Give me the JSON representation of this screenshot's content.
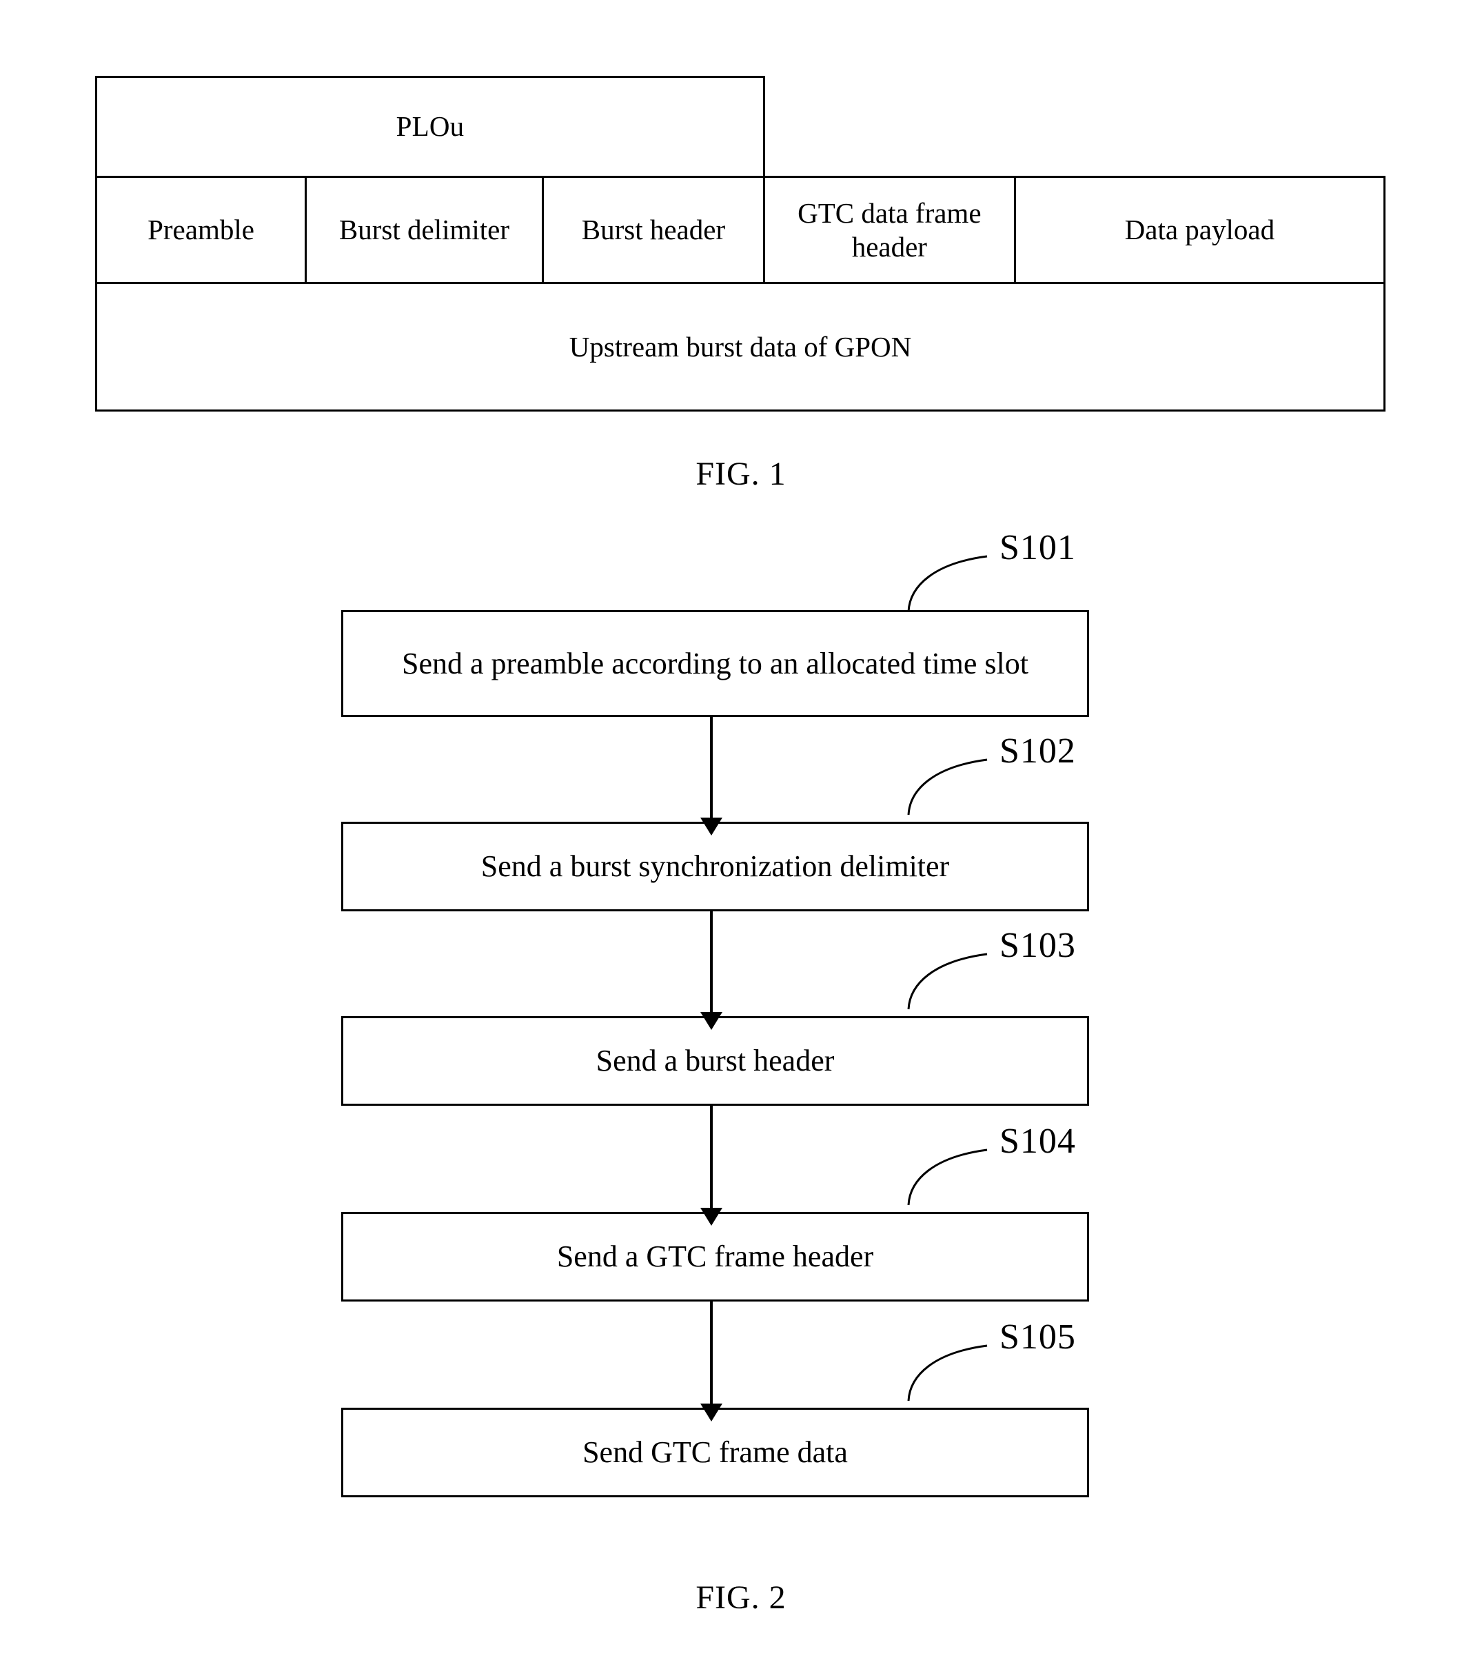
{
  "figure1": {
    "caption": "FIG. 1",
    "ploue_row": {
      "label": "PLOu"
    },
    "component_row": [
      {
        "label": "Preamble"
      },
      {
        "label": "Burst delimiter"
      },
      {
        "label": "Burst header"
      },
      {
        "label": "GTC data frame header"
      },
      {
        "label": "Data payload"
      }
    ],
    "summary_row": {
      "label": "Upstream burst data of GPON"
    }
  },
  "figure2": {
    "caption": "FIG. 2",
    "steps": [
      {
        "id": "S101",
        "text": "Send a preamble according to an allocated time slot"
      },
      {
        "id": "S102",
        "text": "Send a burst synchronization delimiter"
      },
      {
        "id": "S103",
        "text": "Send a burst header"
      },
      {
        "id": "S104",
        "text": "Send a GTC frame header"
      },
      {
        "id": "S105",
        "text": "Send GTC frame data"
      }
    ]
  },
  "colors": {
    "line": "#000000",
    "background": "#ffffff",
    "text": "#000000"
  }
}
